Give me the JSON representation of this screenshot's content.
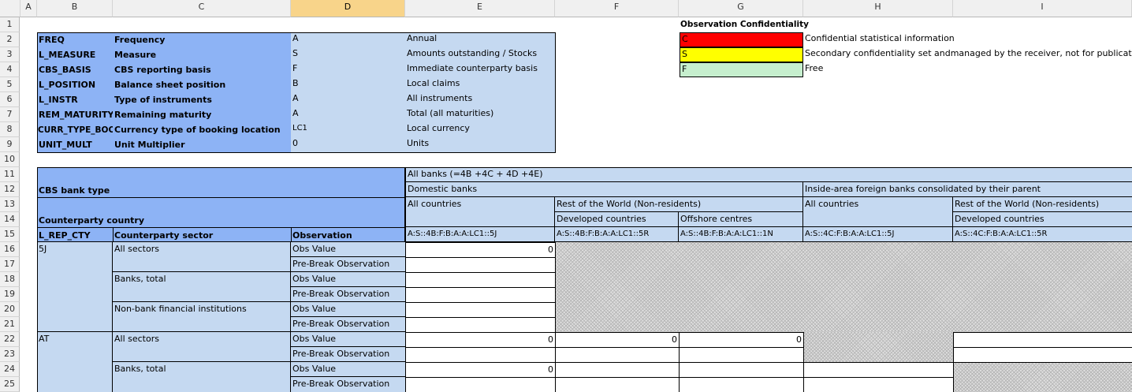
{
  "columns": [
    "A",
    "B",
    "C",
    "D",
    "E",
    "F",
    "G",
    "H",
    "I"
  ],
  "rows": [
    "1",
    "2",
    "3",
    "4",
    "5",
    "6",
    "7",
    "8",
    "9",
    "10",
    "11",
    "12",
    "13",
    "14",
    "15",
    "16",
    "17",
    "18",
    "19",
    "20",
    "21",
    "22",
    "23",
    "24",
    "25"
  ],
  "meta": [
    {
      "code": "FREQ",
      "label": "Frequency",
      "value": "A",
      "desc": "Annual"
    },
    {
      "code": "L_MEASURE",
      "label": "Measure",
      "value": "S",
      "desc": "Amounts outstanding / Stocks"
    },
    {
      "code": "CBS_BASIS",
      "label": "CBS reporting basis",
      "value": "F",
      "desc": "Immediate counterparty basis"
    },
    {
      "code": "L_POSITION",
      "label": "Balance sheet position",
      "value": "B",
      "desc": "Local claims"
    },
    {
      "code": "L_INSTR",
      "label": "Type of instruments",
      "value": "A",
      "desc": "All instruments"
    },
    {
      "code": "REM_MATURITY",
      "label": "Remaining maturity",
      "value": "A",
      "desc": "Total (all maturities)"
    },
    {
      "code": "CURR_TYPE_BOOK",
      "label": "Currency type of booking location",
      "value": "LC1",
      "desc": "Local currency"
    },
    {
      "code": "UNIT_MULT",
      "label": "Unit Multiplier",
      "value": "0",
      "desc": "Units"
    }
  ],
  "confidentiality": {
    "title": "Observation Confidentiality",
    "items": [
      {
        "code": "C",
        "desc": "Confidential statistical information",
        "color": "#ff0000"
      },
      {
        "code": "S",
        "desc": "Secondary confidentiality set andmanaged by the receiver, not for publication",
        "color": "#ffff00"
      },
      {
        "code": "F",
        "desc": "Free",
        "color": "#c6efce"
      }
    ]
  },
  "header": {
    "all_banks": "All banks (=4B +4C + 4D +4E)",
    "cbs_bank_type": "CBS bank type",
    "domestic_banks": "Domestic banks",
    "inside_area": "Inside-area foreign banks consolidated by their parent",
    "counterparty_country": "Counterparty country",
    "all_countries_1": "All countries",
    "rest_world_1": "Rest of the World (Non-residents)",
    "all_countries_2": "All countries",
    "rest_world_2": "Rest of the World (Non-residents)",
    "developed_1": "Developed countries",
    "offshore": "Offshore centres",
    "developed_2": "Developed countries",
    "l_rep_cty": "L_REP_CTY",
    "counterparty_sector": "Counterparty sector",
    "observation": "Observation",
    "key_e": "A:S::4B:F:B:A:A:LC1::5J",
    "key_f": "A:S::4B:F:B:A:A:LC1::5R",
    "key_g": "A:S::4B:F:B:A:A:LC1::1N",
    "key_h": "A:S::4C:F:B:A:A:LC1::5J",
    "key_i": "A:S::4C:F:B:A:A:LC1::5R"
  },
  "body": {
    "cty_5j": "5J",
    "cty_at": "AT",
    "sec_all_1": "All sectors",
    "sec_banks_1": "Banks, total",
    "sec_nbfi": "Non-bank financial institutions",
    "sec_all_2": "All sectors",
    "sec_banks_2": "Banks, total",
    "obs_value": "Obs Value",
    "pre_break": "Pre-Break Observation",
    "v16e": "0",
    "v22e": "0",
    "v22f": "0",
    "v22g": "0",
    "v24e": "0"
  }
}
